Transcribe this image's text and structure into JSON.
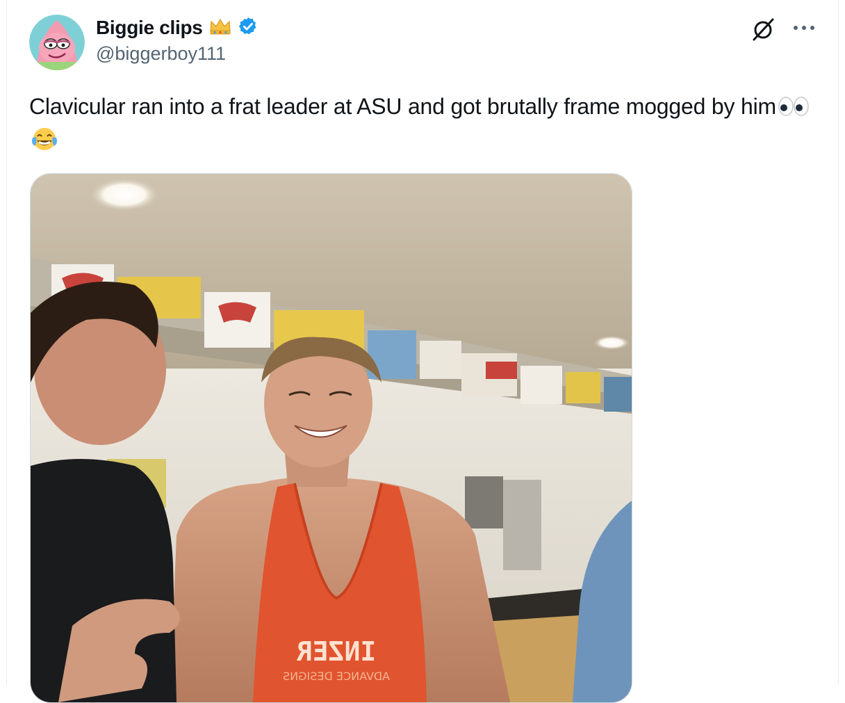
{
  "tweet": {
    "author": {
      "display_name": "Biggie clips",
      "handle": "@biggerboy111",
      "crown_icon": "crown-icon",
      "verified_icon": "verified-badge-icon",
      "verified_color": "#1d9bf0"
    },
    "text_before_emoji": "Clavicular ran into a frat leader at ASU and got brutally frame mogged by him",
    "emojis": [
      "eyes-emoji",
      "tears-of-joy-emoji"
    ],
    "actions": {
      "grok_icon": "grok-icon",
      "more_icon": "more-icon"
    },
    "media": {
      "kind": "video-still",
      "shirt_print": "INZER",
      "shirt_subprint": "ADVANCE DESIGNS"
    }
  },
  "colors": {
    "text_primary": "#0f1419",
    "text_secondary": "#536471",
    "border": "#cfd9de"
  }
}
